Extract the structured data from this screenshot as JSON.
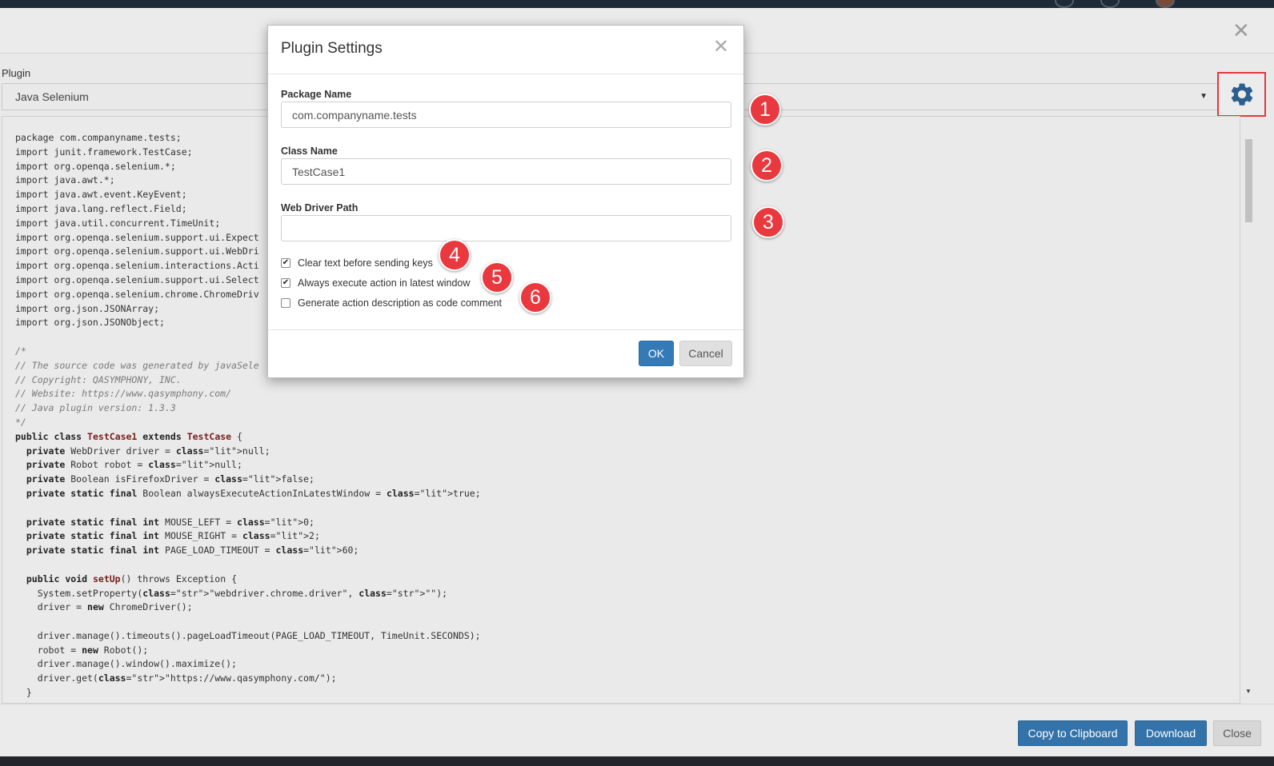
{
  "outer_modal": {
    "close_glyph": "✕",
    "plugin_label": "Plugin",
    "plugin_value": "Java Selenium",
    "settings_icon": "gear-icon",
    "code_lines": [
      "package com.companyname.tests;",
      "import junit.framework.TestCase;",
      "import org.openqa.selenium.*;",
      "import java.awt.*;",
      "import java.awt.event.KeyEvent;",
      "import java.lang.reflect.Field;",
      "import java.util.concurrent.TimeUnit;",
      "import org.openqa.selenium.support.ui.Expect",
      "import org.openqa.selenium.support.ui.WebDri",
      "import org.openqa.selenium.interactions.Acti",
      "import org.openqa.selenium.support.ui.Select",
      "import org.openqa.selenium.chrome.ChromeDriv",
      "import org.json.JSONArray;",
      "import org.json.JSONObject;",
      "",
      "/*",
      "// The source code was generated by javaSele",
      "// Copyright: QASYMPHONY, INC.",
      "// Website: https://www.qasymphony.com/",
      "// Java plugin version: 1.3.3",
      "*/",
      "public class TestCase1 extends TestCase {",
      "  private WebDriver driver = null;",
      "  private Robot robot = null;",
      "  private Boolean isFirefoxDriver = false;",
      "  private static final Boolean alwaysExecuteActionInLatestWindow = true;",
      "",
      "  private static final int MOUSE_LEFT = 0;",
      "  private static final int MOUSE_RIGHT = 2;",
      "  private static final int PAGE_LOAD_TIMEOUT = 60;",
      "",
      "  public void setUp() throws Exception {",
      "    System.setProperty(\"webdriver.chrome.driver\", \"\");",
      "    driver = new ChromeDriver();",
      "",
      "    driver.manage().timeouts().pageLoadTimeout(PAGE_LOAD_TIMEOUT, TimeUnit.SECONDS);",
      "    robot = new Robot();",
      "    driver.manage().window().maximize();",
      "    driver.get(\"https://www.qasymphony.com/\");",
      "  }"
    ],
    "footer": {
      "copy_label": "Copy to Clipboard",
      "download_label": "Download",
      "close_label": "Close"
    }
  },
  "dialog": {
    "title": "Plugin Settings",
    "close_glyph": "✕",
    "package_label": "Package Name",
    "package_value": "com.companyname.tests",
    "class_label": "Class Name",
    "class_value": "TestCase1",
    "driver_label": "Web Driver Path",
    "driver_value": "",
    "checkboxes": [
      {
        "label": "Clear text before sending keys",
        "checked": true
      },
      {
        "label": "Always execute action in latest window",
        "checked": true
      },
      {
        "label": "Generate action description as code comment",
        "checked": false
      }
    ],
    "ok_label": "OK",
    "cancel_label": "Cancel"
  },
  "markers": [
    "1",
    "2",
    "3",
    "4",
    "5",
    "6"
  ],
  "colors": {
    "marker_red": "#e9393f",
    "primary_blue": "#337ab7",
    "highlight_border": "#e0393f"
  }
}
